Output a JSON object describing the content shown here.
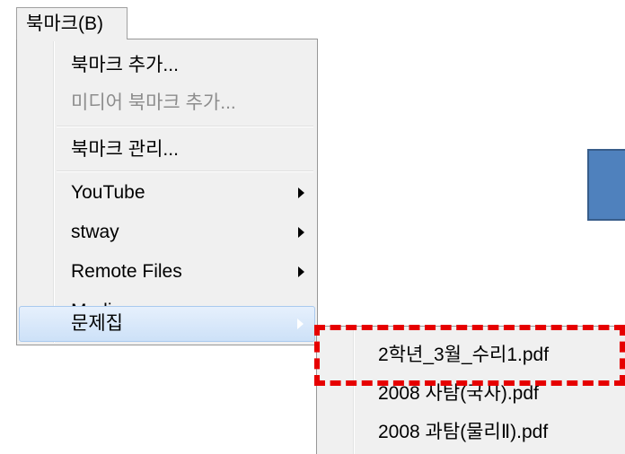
{
  "menubar": {
    "bookmark_menu_label": "북마크(B)"
  },
  "menu": {
    "items": [
      {
        "label": "북마크 추가...",
        "disabled": false,
        "submenu": false
      },
      {
        "label": "미디어 북마크 추가...",
        "disabled": true,
        "submenu": false
      },
      {
        "label": "북마크 관리...",
        "disabled": false,
        "submenu": false
      },
      {
        "label": "YouTube",
        "disabled": false,
        "submenu": true
      },
      {
        "label": "stway",
        "disabled": false,
        "submenu": true
      },
      {
        "label": "Remote Files",
        "disabled": false,
        "submenu": true
      },
      {
        "label": "Media",
        "disabled": false,
        "submenu": true
      },
      {
        "label": "문제집",
        "disabled": false,
        "submenu": true,
        "highlighted": true
      }
    ]
  },
  "submenu": {
    "items": [
      {
        "label": "2학년_3월_수리1.pdf"
      },
      {
        "label": "2008 사탐(국사).pdf"
      },
      {
        "label": "2008 과탐(물리Ⅱ).pdf"
      }
    ]
  },
  "colors": {
    "menu_bg": "#f0f0f0",
    "highlight_bg": "#cde1f8",
    "annotation_red": "#e60000",
    "shape_blue": "#4f81bd"
  }
}
